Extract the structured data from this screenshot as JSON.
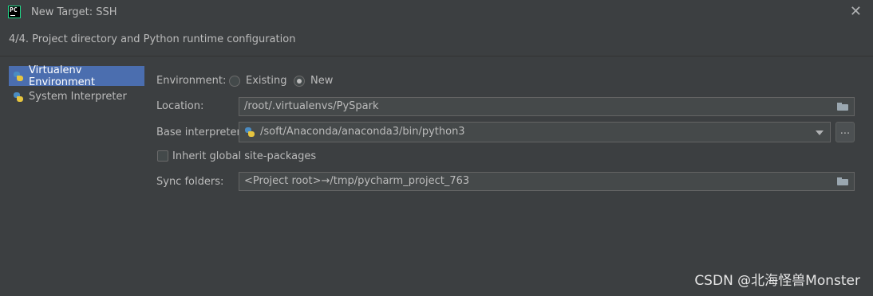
{
  "window": {
    "title": "New Target: SSH",
    "close_glyph": "✕",
    "app_icon_text": "PC"
  },
  "step": "4/4. Project directory and Python runtime configuration",
  "sidebar": {
    "items": [
      {
        "label": "Virtualenv Environment",
        "icon": "python-icon",
        "selected": true
      },
      {
        "label": "System Interpreter",
        "icon": "python-icon",
        "selected": false
      }
    ]
  },
  "form": {
    "environment": {
      "label": "Environment:",
      "options": [
        {
          "label": "Existing",
          "checked": false
        },
        {
          "label": "New",
          "checked": true
        }
      ]
    },
    "location": {
      "label": "Location:",
      "value": "/root/.virtualenvs/PySpark"
    },
    "base_interpreter": {
      "label": "Base interpreter:",
      "value": "/soft/Anaconda/anaconda3/bin/python3",
      "browse_label": "..."
    },
    "inherit": {
      "label": "Inherit global site-packages",
      "checked": false
    },
    "sync_folders": {
      "label": "Sync folders:",
      "value": "<Project root>→/tmp/pycharm_project_763"
    }
  },
  "watermark": "CSDN @北海怪兽Monster",
  "colors": {
    "background": "#3c3f41",
    "selection": "#4b6eaf",
    "field_bg": "#45494a",
    "text": "#bbbbbb"
  }
}
